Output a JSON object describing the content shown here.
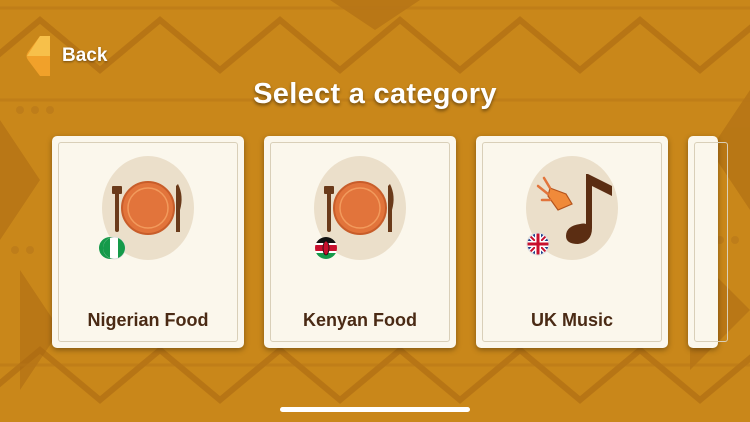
{
  "header": {
    "back_label": "Back",
    "title": "Select a category"
  },
  "categories": [
    {
      "label": "Nigerian Food",
      "icon": "plate-fork-knife-icon",
      "flag": "nigeria-flag-icon"
    },
    {
      "label": "Kenyan Food",
      "icon": "plate-fork-knife-icon",
      "flag": "kenya-flag-icon"
    },
    {
      "label": "UK Music",
      "icon": "music-note-horn-icon",
      "flag": "uk-flag-icon"
    }
  ],
  "colors": {
    "background": "#c9871a",
    "pattern": "#a96812",
    "card": "#fbf7ec",
    "label": "#4a2a14",
    "plate": "#e2743b"
  }
}
